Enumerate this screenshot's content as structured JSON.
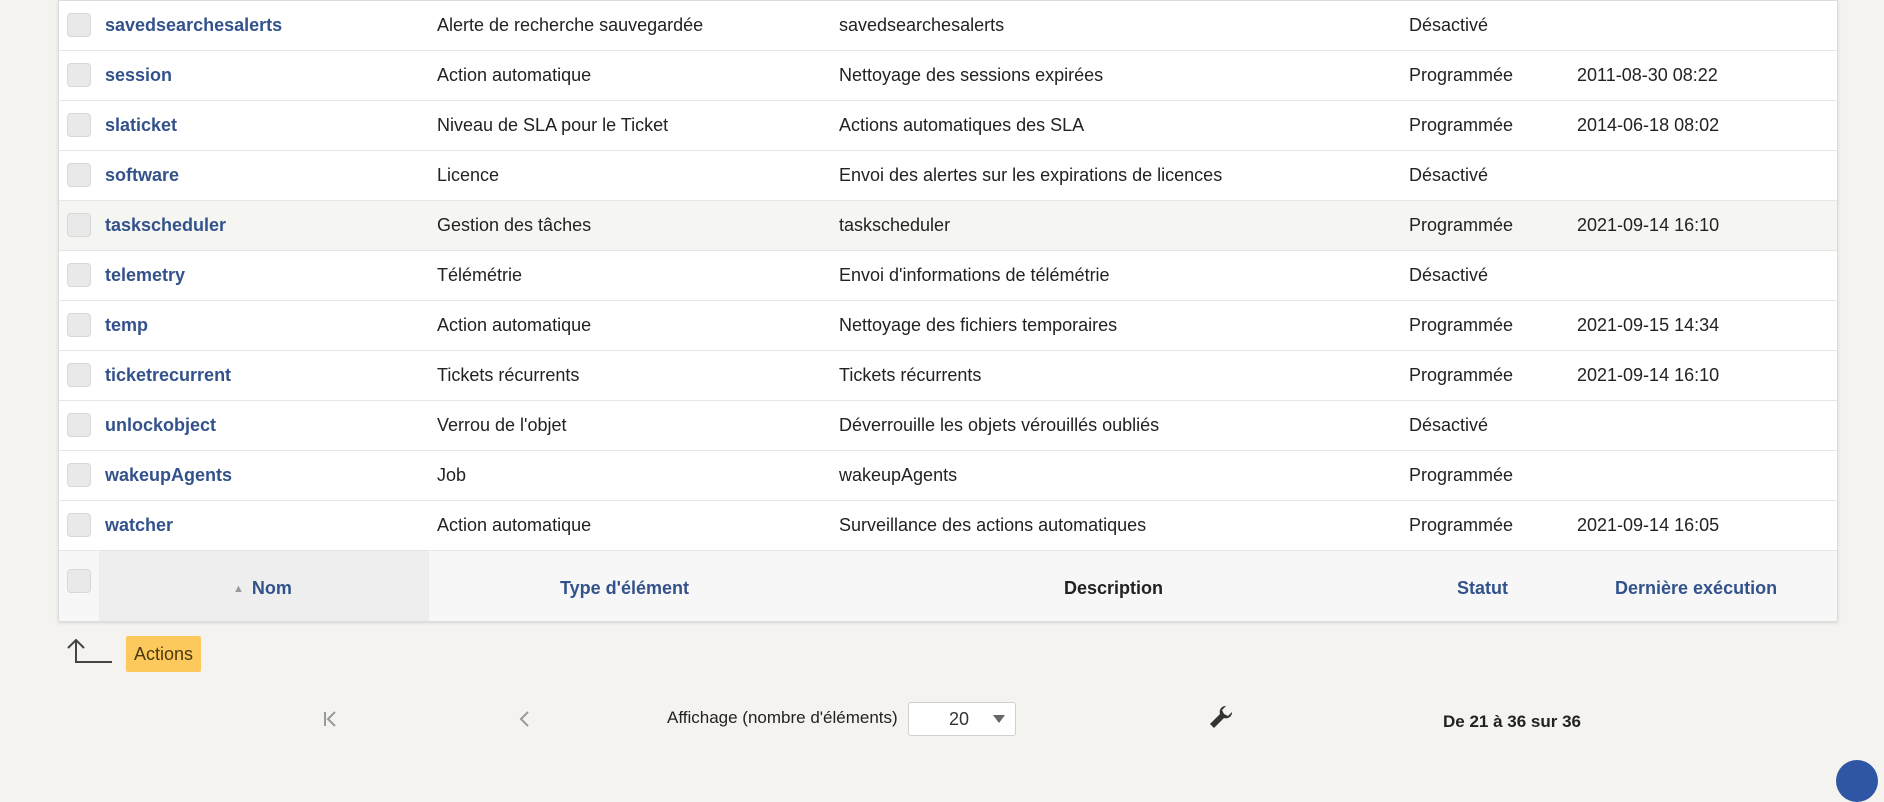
{
  "rows": [
    {
      "name": "savedsearchesalerts",
      "type": "Alerte de recherche sauvegardée",
      "description": "savedsearchesalerts",
      "status": "Désactivé",
      "last_run": ""
    },
    {
      "name": "session",
      "type": "Action automatique",
      "description": "Nettoyage des sessions expirées",
      "status": "Programmée",
      "last_run": "2011-08-30 08:22"
    },
    {
      "name": "slaticket",
      "type": "Niveau de SLA pour le Ticket",
      "description": "Actions automatiques des SLA",
      "status": "Programmée",
      "last_run": "2014-06-18 08:02"
    },
    {
      "name": "software",
      "type": "Licence",
      "description": "Envoi des alertes sur les expirations de licences",
      "status": "Désactivé",
      "last_run": ""
    },
    {
      "name": "taskscheduler",
      "type": "Gestion des tâches",
      "description": "taskscheduler",
      "status": "Programmée",
      "last_run": "2021-09-14 16:10"
    },
    {
      "name": "telemetry",
      "type": "Télémétrie",
      "description": "Envoi d'informations de télémétrie",
      "status": "Désactivé",
      "last_run": ""
    },
    {
      "name": "temp",
      "type": "Action automatique",
      "description": "Nettoyage des fichiers temporaires",
      "status": "Programmée",
      "last_run": "2021-09-15 14:34"
    },
    {
      "name": "ticketrecurrent",
      "type": "Tickets récurrents",
      "description": "Tickets récurrents",
      "status": "Programmée",
      "last_run": "2021-09-14 16:10"
    },
    {
      "name": "unlockobject",
      "type": "Verrou de l'objet",
      "description": "Déverrouille les objets vérouillés oubliés",
      "status": "Désactivé",
      "last_run": ""
    },
    {
      "name": "wakeupAgents",
      "type": "Job",
      "description": "wakeupAgents",
      "status": "Programmée",
      "last_run": ""
    },
    {
      "name": "watcher",
      "type": "Action automatique",
      "description": "Surveillance des actions automatiques",
      "status": "Programmée",
      "last_run": "2021-09-14 16:05"
    }
  ],
  "header": {
    "name": "Nom",
    "type": "Type d'élément",
    "description": "Description",
    "status": "Statut",
    "last_run": "Dernière exécution"
  },
  "actions": {
    "label": "Actions"
  },
  "pager": {
    "display_label": "Affichage (nombre d'éléments)",
    "page_size": "20",
    "range_text": "De 21 à 36 sur 36"
  },
  "icons": {
    "first_page": "first-page-icon",
    "prev_page": "previous-page-icon",
    "wrench": "wrench-icon",
    "actions_arrow": "up-arrow-icon"
  },
  "colors": {
    "link": "#33528b",
    "actions_button": "#fec95c",
    "background": "#f4f3ef"
  }
}
